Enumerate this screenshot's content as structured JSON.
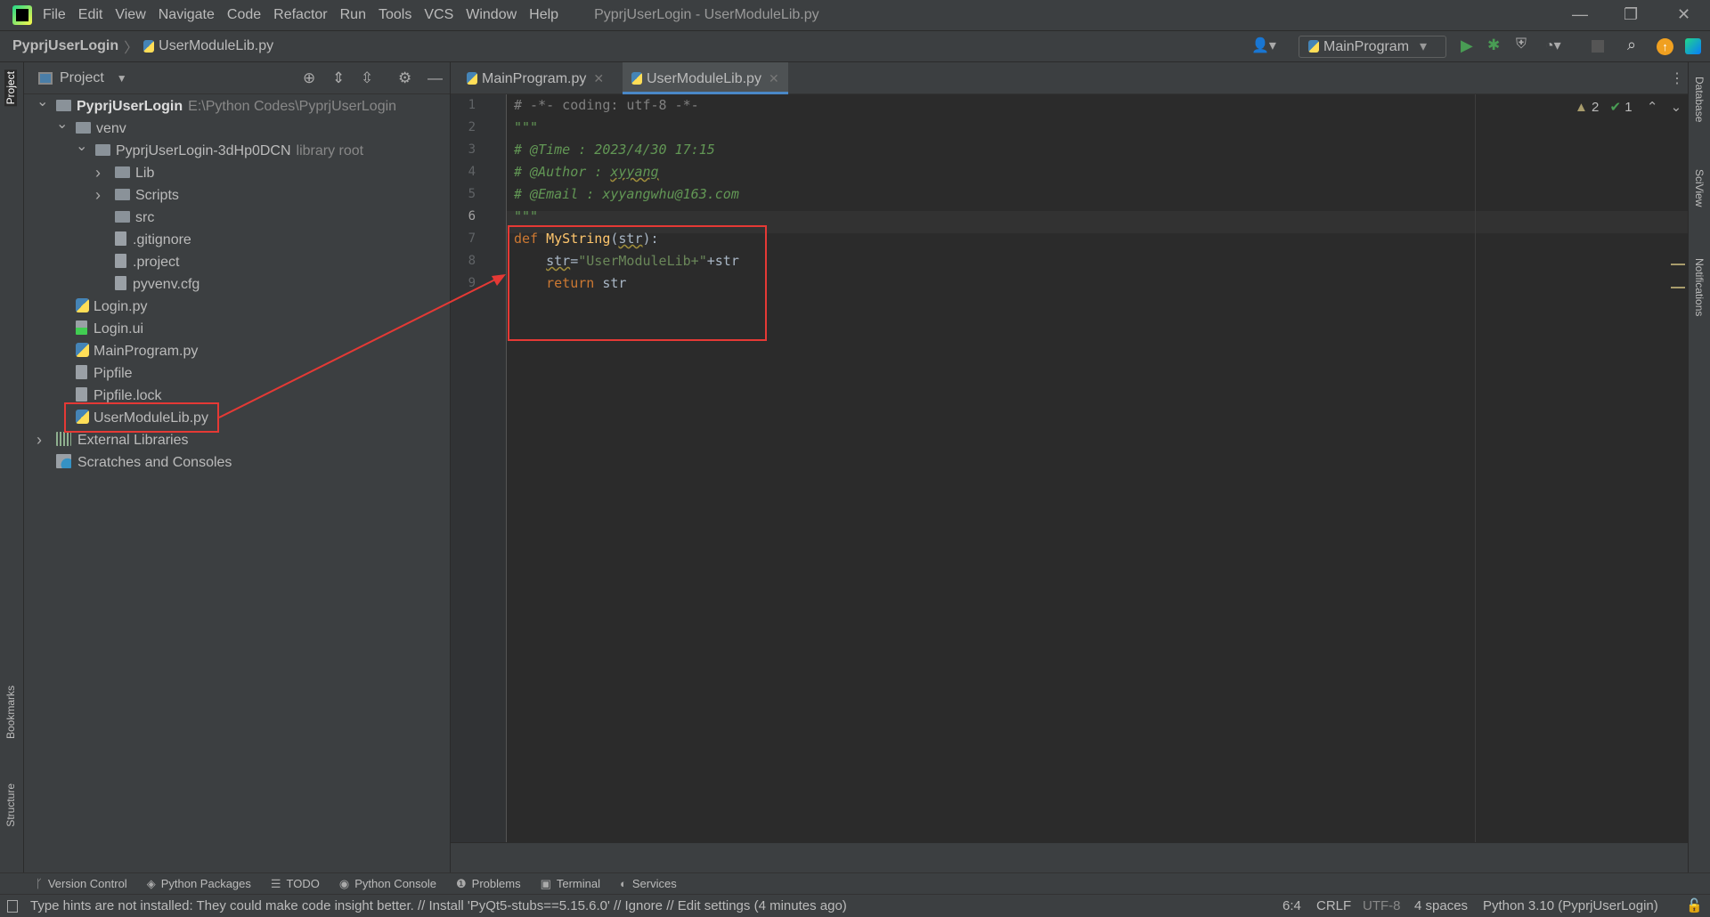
{
  "titlebar": {
    "menu": [
      "File",
      "Edit",
      "View",
      "Navigate",
      "Code",
      "Refactor",
      "Run",
      "Tools",
      "VCS",
      "Window",
      "Help"
    ],
    "title": "PyprjUserLogin - UserModuleLib.py"
  },
  "navbar": {
    "project": "PyprjUserLogin",
    "file": "UserModuleLib.py",
    "run_config": "MainProgram"
  },
  "left_strip": {
    "project": "Project",
    "bookmarks": "Bookmarks",
    "structure": "Structure"
  },
  "right_strip": {
    "database": "Database",
    "sciview": "SciView",
    "notifications": "Notifications"
  },
  "project_panel": {
    "title": "Project",
    "tree": [
      {
        "label": "PyprjUserLogin",
        "hint": "E:\\Python Codes\\PyprjUserLogin",
        "level": 0,
        "type": "folder",
        "state": "open",
        "bold": true
      },
      {
        "label": "venv",
        "level": 1,
        "type": "folder",
        "state": "open"
      },
      {
        "label": "PyprjUserLogin-3dHp0DCN",
        "hint": "library root",
        "level": 2,
        "type": "folder",
        "state": "open"
      },
      {
        "label": "Lib",
        "level": 3,
        "type": "folder",
        "state": "closed"
      },
      {
        "label": "Scripts",
        "level": 3,
        "type": "folder",
        "state": "closed"
      },
      {
        "label": "src",
        "level": 3,
        "type": "folder"
      },
      {
        "label": ".gitignore",
        "level": 3,
        "type": "file"
      },
      {
        "label": ".project",
        "level": 3,
        "type": "file"
      },
      {
        "label": "pyvenv.cfg",
        "level": 3,
        "type": "file"
      },
      {
        "label": "Login.py",
        "level": 1,
        "type": "python"
      },
      {
        "label": "Login.ui",
        "level": 1,
        "type": "qt"
      },
      {
        "label": "MainProgram.py",
        "level": 1,
        "type": "python"
      },
      {
        "label": "Pipfile",
        "level": 1,
        "type": "file"
      },
      {
        "label": "Pipfile.lock",
        "level": 1,
        "type": "file"
      },
      {
        "label": "UserModuleLib.py",
        "level": 1,
        "type": "python",
        "highlighted": true
      },
      {
        "label": "External Libraries",
        "level": 0,
        "type": "library",
        "state": "closed"
      },
      {
        "label": "Scratches and Consoles",
        "level": 0,
        "type": "scratch"
      }
    ]
  },
  "tabs": [
    {
      "label": "MainProgram.py",
      "active": false
    },
    {
      "label": "UserModuleLib.py",
      "active": true
    }
  ],
  "inspections": {
    "warnings": "2",
    "typos": "1"
  },
  "code": [
    [
      {
        "t": "# -*- coding: utf-8 -*-",
        "c": "cm-gray"
      }
    ],
    [
      {
        "t": "\"\"\"",
        "c": "cm-doc"
      }
    ],
    [
      {
        "t": "# @Time : 2023/4/30 17:15",
        "c": "cm-doc"
      }
    ],
    [
      {
        "t": "# @Author : ",
        "c": "cm-doc"
      },
      {
        "t": "xyyang",
        "c": "cm-doc wavy"
      }
    ],
    [
      {
        "t": "# @Email : xyyangwhu@163.com",
        "c": "cm-doc"
      }
    ],
    [
      {
        "t": "\"\"\"",
        "c": "cm-doc"
      }
    ],
    [
      {
        "t": "def ",
        "c": "kw"
      },
      {
        "t": "MyString",
        "c": "fn"
      },
      {
        "t": "(",
        "c": ""
      },
      {
        "t": "str",
        "c": "wavy"
      },
      {
        "t": "):",
        "c": ""
      }
    ],
    [
      {
        "t": "    ",
        "c": ""
      },
      {
        "t": "str",
        "c": "wavy"
      },
      {
        "t": "=",
        "c": ""
      },
      {
        "t": "\"UserModuleLib+\"",
        "c": "st"
      },
      {
        "t": "+str",
        "c": ""
      }
    ],
    [
      {
        "t": "    ",
        "c": ""
      },
      {
        "t": "return",
        "c": "kw"
      },
      {
        "t": " str",
        "c": ""
      }
    ]
  ],
  "tool_windows": [
    "Version Control",
    "Python Packages",
    "TODO",
    "Python Console",
    "Problems",
    "Terminal",
    "Services"
  ],
  "status": {
    "message": "Type hints are not installed: They could make code insight better. // Install 'PyQt5-stubs==5.15.6.0' // Ignore // Edit settings (4 minutes ago)",
    "position": "6:4",
    "line_sep": "CRLF",
    "encoding": "UTF-8",
    "indent": "4 spaces",
    "interpreter": "Python 3.10 (PyprjUserLogin)"
  },
  "colors": {
    "annotation": "#e53935",
    "accent": "#4a88c7",
    "run": "#499c54"
  }
}
